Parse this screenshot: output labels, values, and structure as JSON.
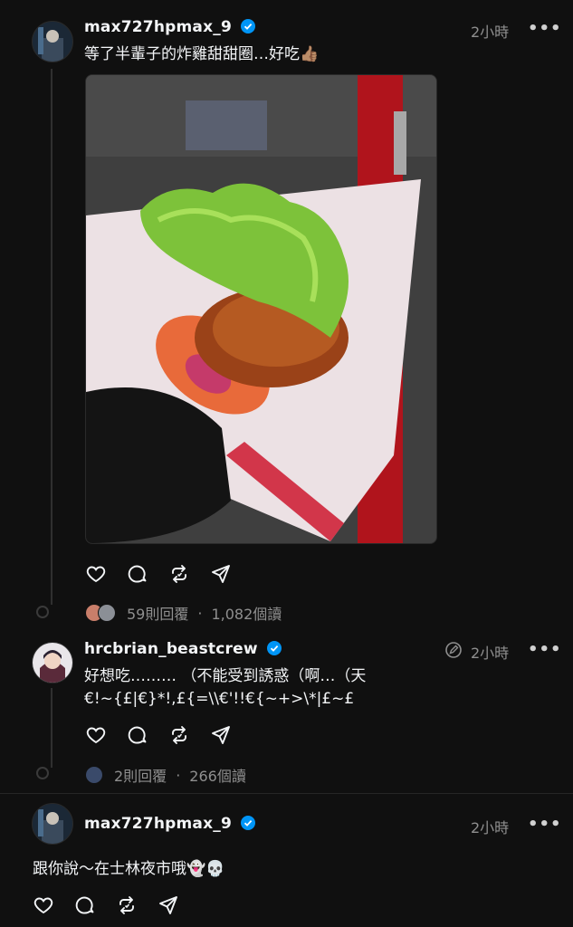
{
  "post": {
    "username": "max727hpmax_9",
    "time": "2小時",
    "more": "•••",
    "text": "等了半輩子的炸雞甜甜圈…好吃👍🏽",
    "replies": "59則回覆",
    "separator": "·",
    "views": "1,082個讀"
  },
  "reply": {
    "username": "hrcbrian_beastcrew",
    "time": "2小時",
    "more": "•••",
    "text_line1": "好想吃……… （不能受到誘惑（啊…（天",
    "text_line2": "€!~{£|€}*!,£{=\\\\€'!!€{~+>\\*|£~£",
    "replies": "2則回覆",
    "separator": "·",
    "views": "266個讀"
  },
  "post2": {
    "username": "max727hpmax_9",
    "time": "2小時",
    "more": "•••",
    "text": "跟你說～在士林夜市哦👻💀"
  },
  "colors": {
    "background": "#101010",
    "text": "#f3f5f7",
    "muted": "#8f8f8f",
    "verified": "#0095f6",
    "thread_line": "#2f2f2f"
  }
}
